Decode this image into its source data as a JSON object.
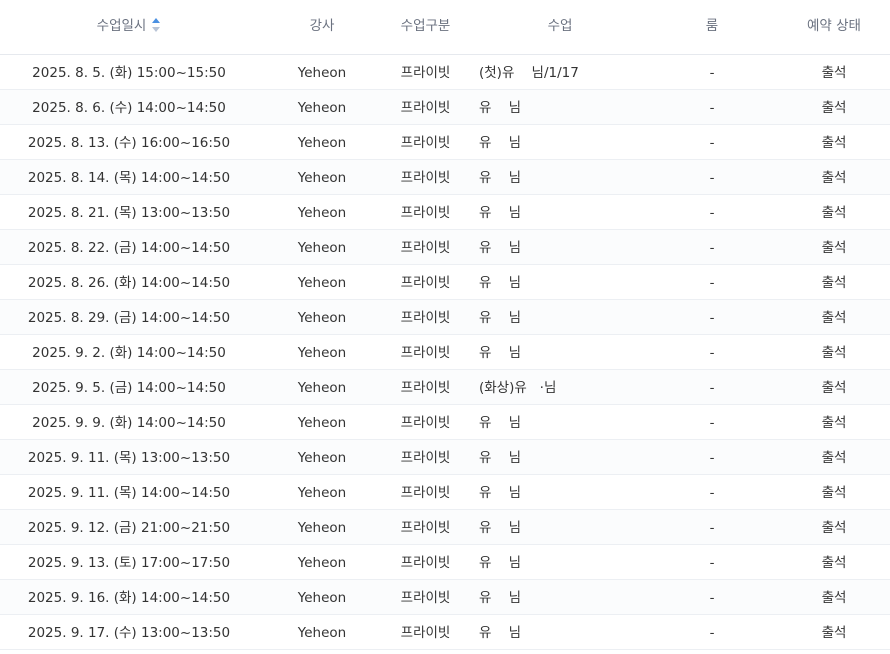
{
  "headers": {
    "date": "수업일시",
    "instructor": "강사",
    "class_type": "수업구분",
    "class": "수업",
    "room": "룸",
    "status": "예약 상태"
  },
  "sort_icon": "sort-up-down-icon",
  "rows": [
    {
      "date": "2025. 8. 5. (화) 15:00~15:50",
      "instructor": "Yeheon",
      "class_type": "프라이빗",
      "class": "(첫)유    님/1/17",
      "room": "-",
      "status": "출석"
    },
    {
      "date": "2025. 8. 6. (수) 14:00~14:50",
      "instructor": "Yeheon",
      "class_type": "프라이빗",
      "class": "유    님",
      "room": "-",
      "status": "출석"
    },
    {
      "date": "2025. 8. 13. (수) 16:00~16:50",
      "instructor": "Yeheon",
      "class_type": "프라이빗",
      "class": "유    님",
      "room": "-",
      "status": "출석"
    },
    {
      "date": "2025. 8. 14. (목) 14:00~14:50",
      "instructor": "Yeheon",
      "class_type": "프라이빗",
      "class": "유    님",
      "room": "-",
      "status": "출석"
    },
    {
      "date": "2025. 8. 21. (목) 13:00~13:50",
      "instructor": "Yeheon",
      "class_type": "프라이빗",
      "class": "유    님",
      "room": "-",
      "status": "출석"
    },
    {
      "date": "2025. 8. 22. (금) 14:00~14:50",
      "instructor": "Yeheon",
      "class_type": "프라이빗",
      "class": "유    님",
      "room": "-",
      "status": "출석"
    },
    {
      "date": "2025. 8. 26. (화) 14:00~14:50",
      "instructor": "Yeheon",
      "class_type": "프라이빗",
      "class": "유    님",
      "room": "-",
      "status": "출석"
    },
    {
      "date": "2025. 8. 29. (금) 14:00~14:50",
      "instructor": "Yeheon",
      "class_type": "프라이빗",
      "class": "유    님",
      "room": "-",
      "status": "출석"
    },
    {
      "date": "2025. 9. 2. (화) 14:00~14:50",
      "instructor": "Yeheon",
      "class_type": "프라이빗",
      "class": "유    님",
      "room": "-",
      "status": "출석"
    },
    {
      "date": "2025. 9. 5. (금) 14:00~14:50",
      "instructor": "Yeheon",
      "class_type": "프라이빗",
      "class": "(화상)유   ·님",
      "room": "-",
      "status": "출석"
    },
    {
      "date": "2025. 9. 9. (화) 14:00~14:50",
      "instructor": "Yeheon",
      "class_type": "프라이빗",
      "class": "유    님",
      "room": "-",
      "status": "출석"
    },
    {
      "date": "2025. 9. 11. (목) 13:00~13:50",
      "instructor": "Yeheon",
      "class_type": "프라이빗",
      "class": "유    님",
      "room": "-",
      "status": "출석"
    },
    {
      "date": "2025. 9. 11. (목) 14:00~14:50",
      "instructor": "Yeheon",
      "class_type": "프라이빗",
      "class": "유    님",
      "room": "-",
      "status": "출석"
    },
    {
      "date": "2025. 9. 12. (금) 21:00~21:50",
      "instructor": "Yeheon",
      "class_type": "프라이빗",
      "class": "유    님",
      "room": "-",
      "status": "출석"
    },
    {
      "date": "2025. 9. 13. (토) 17:00~17:50",
      "instructor": "Yeheon",
      "class_type": "프라이빗",
      "class": "유    님",
      "room": "-",
      "status": "출석"
    },
    {
      "date": "2025. 9. 16. (화) 14:00~14:50",
      "instructor": "Yeheon",
      "class_type": "프라이빗",
      "class": "유    님",
      "room": "-",
      "status": "출석"
    },
    {
      "date": "2025. 9. 17. (수) 13:00~13:50",
      "instructor": "Yeheon",
      "class_type": "프라이빗",
      "class": "유    님",
      "room": "-",
      "status": "출석"
    }
  ]
}
